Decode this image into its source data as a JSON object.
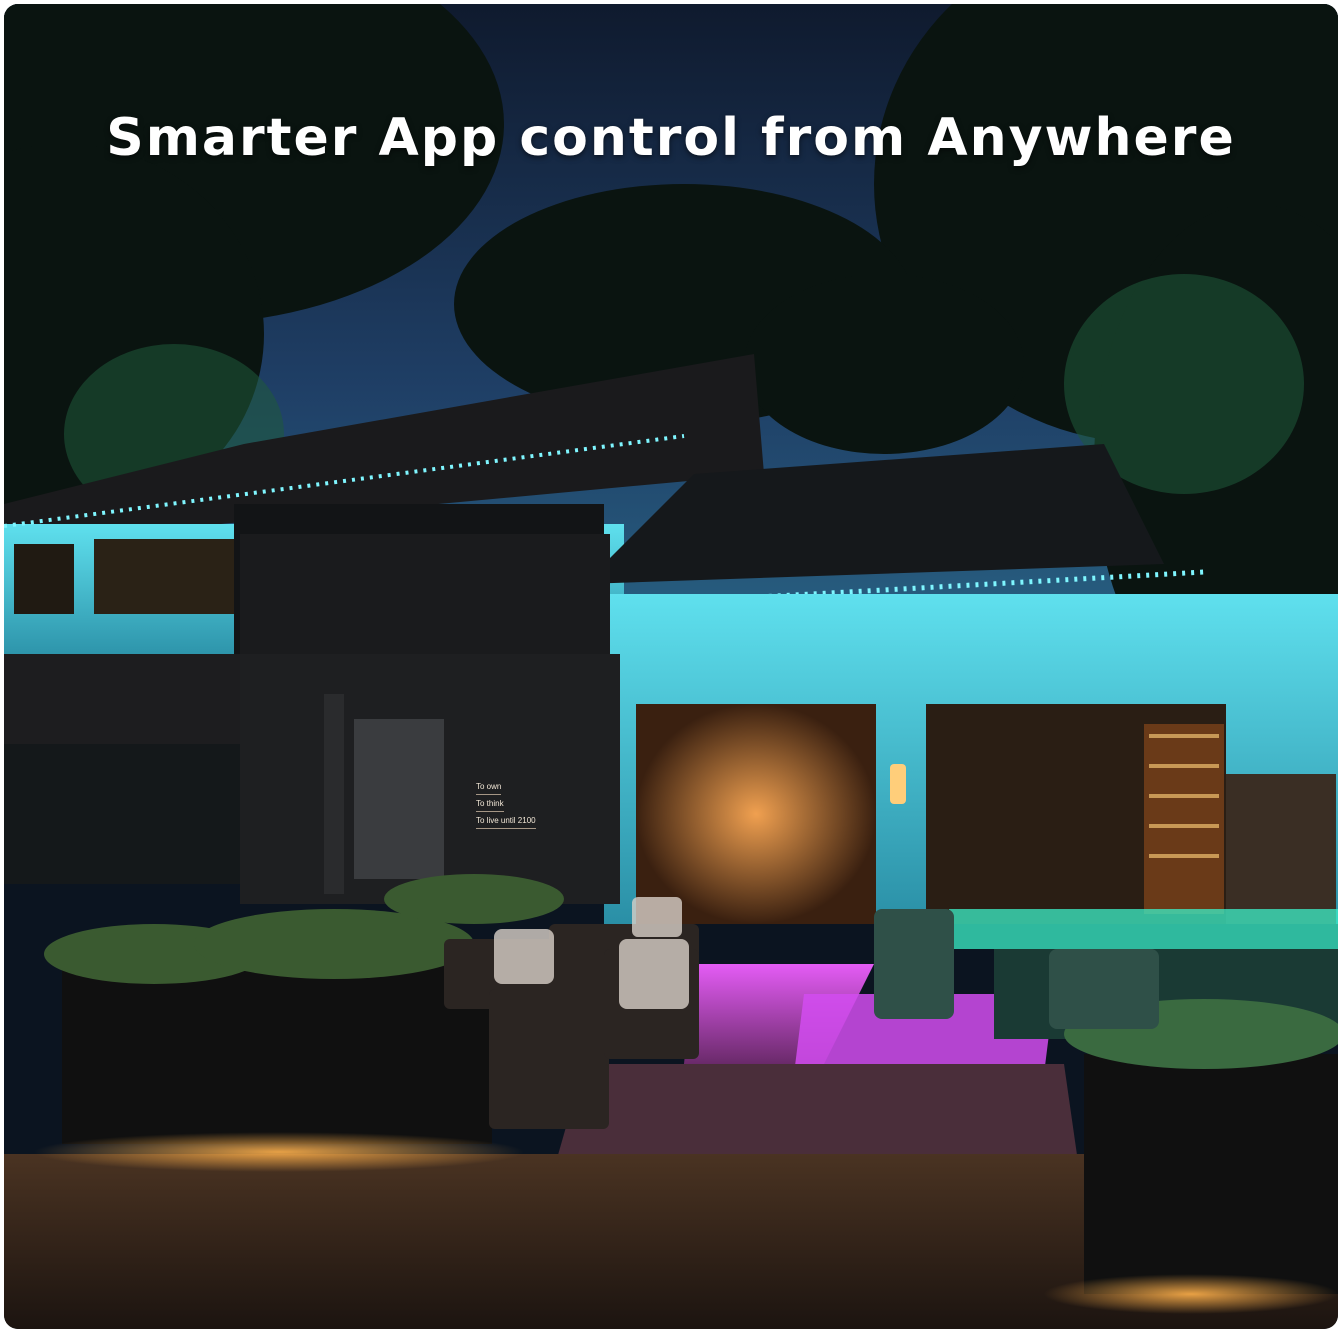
{
  "headline": "Smarter App control from Anywhere",
  "neon_sign": {
    "line1": "To own",
    "line2": "To think",
    "line3": "To live until 2100"
  },
  "colors": {
    "sky": "#1f3f66",
    "cyan_light": "#3fd6e6",
    "magenta_light": "#d23cf0",
    "amber_light": "#f0a040",
    "green_light": "#3cf0c8"
  }
}
